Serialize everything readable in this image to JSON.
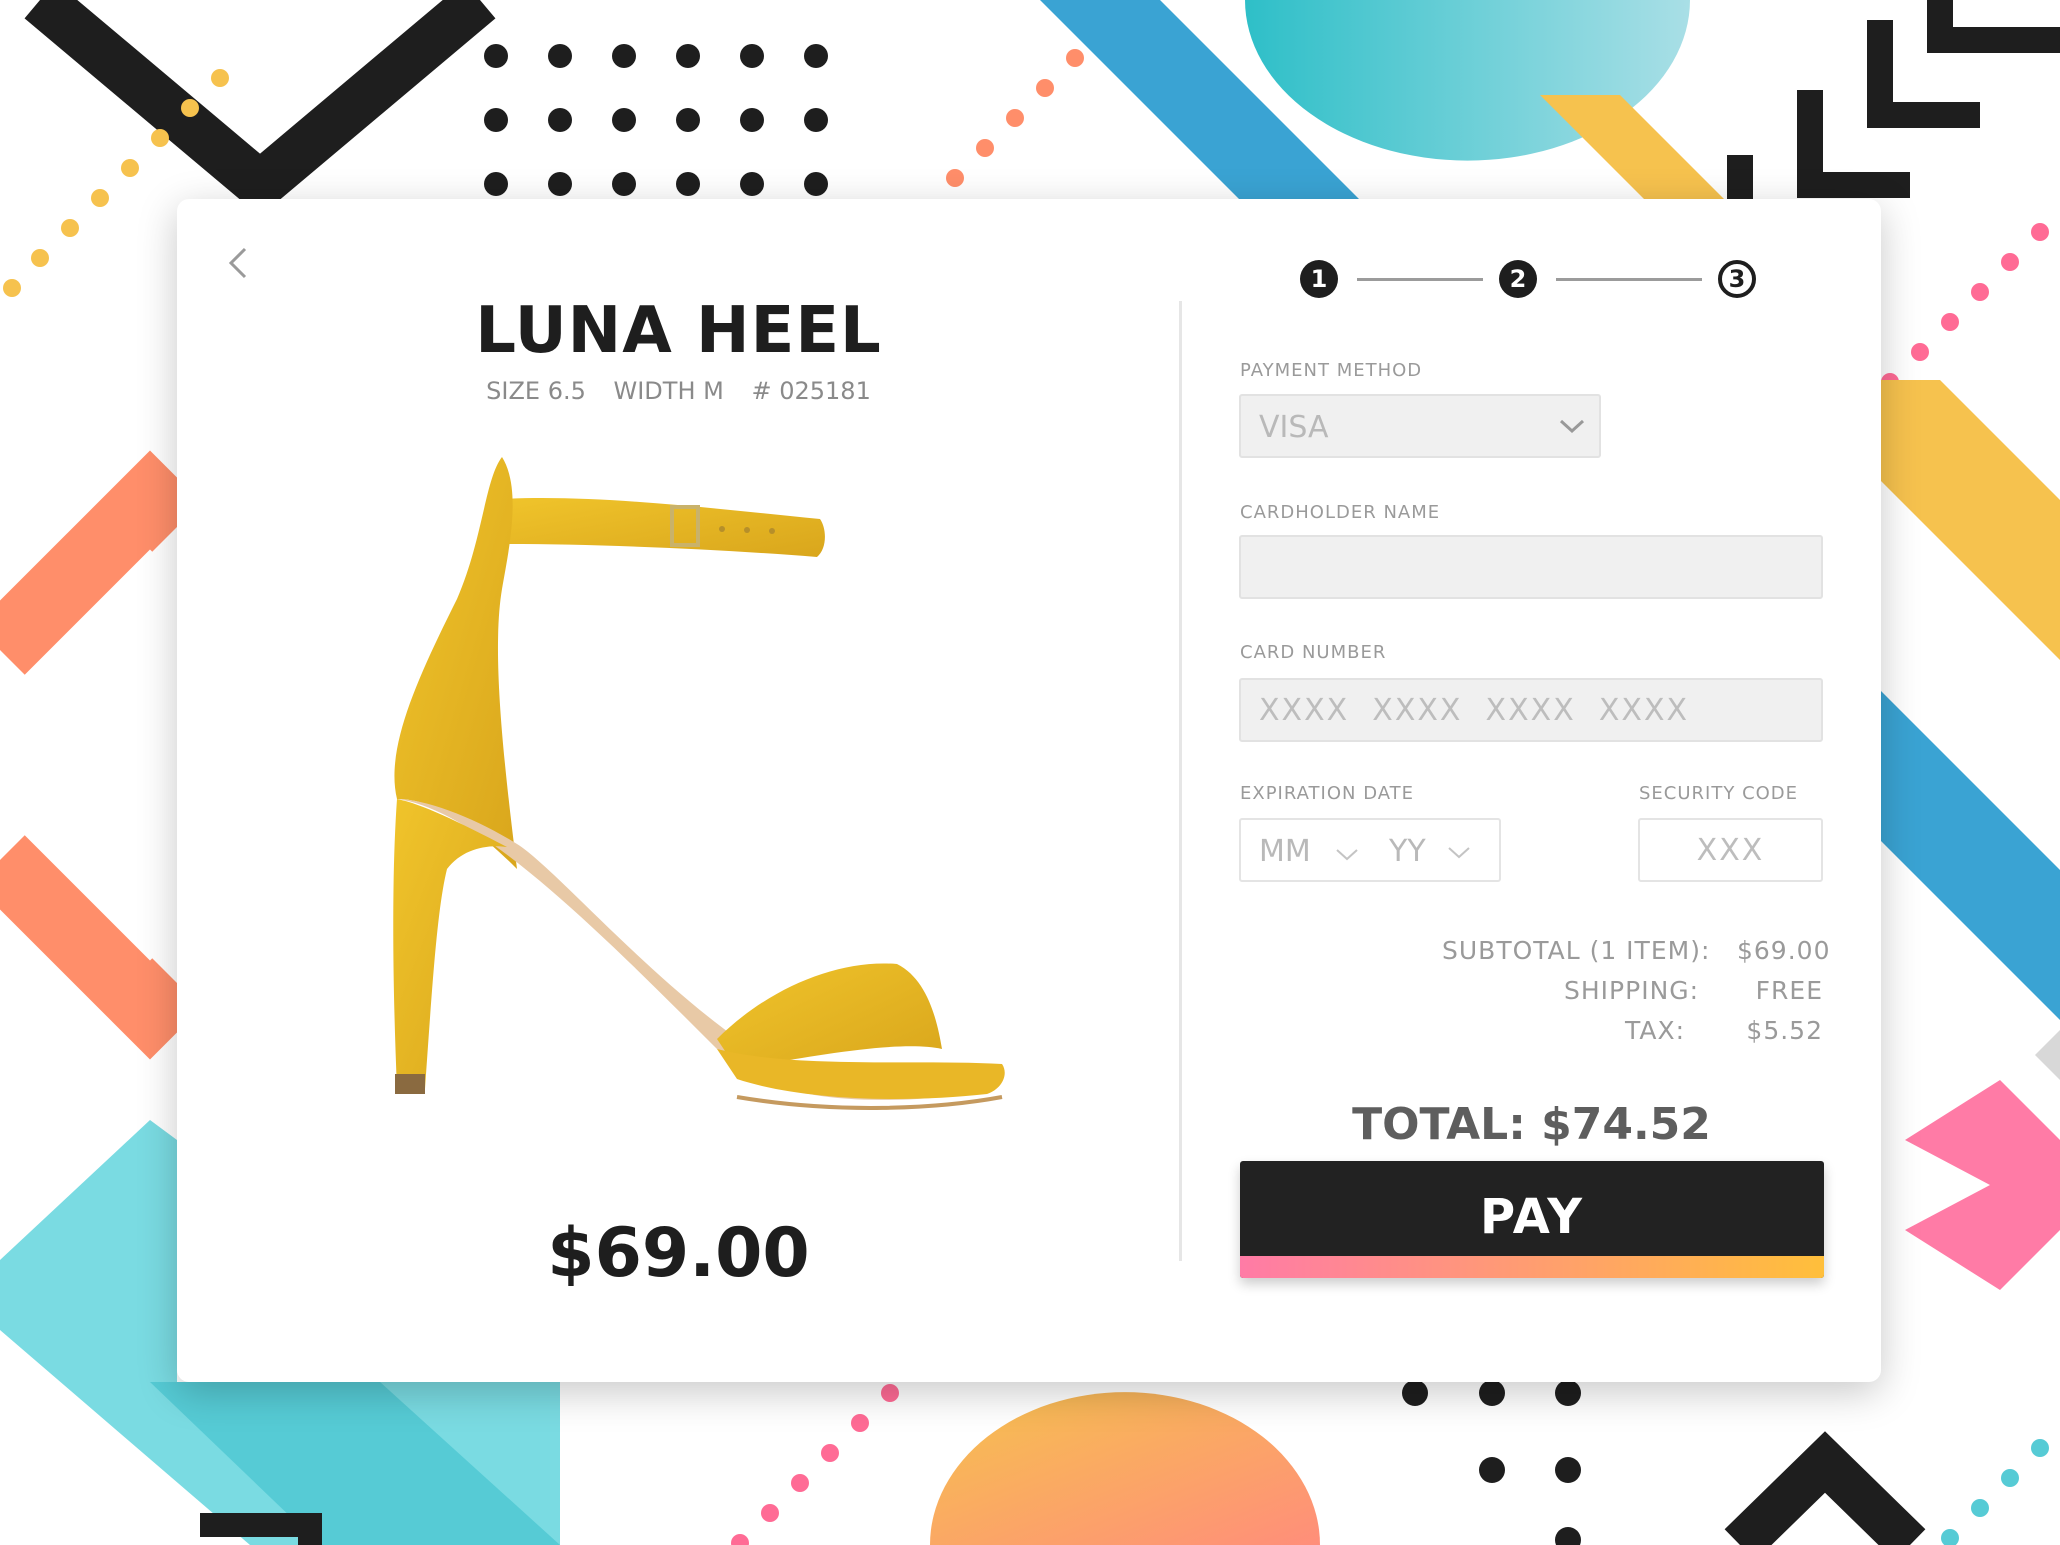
{
  "product": {
    "name": "LUNA HEEL",
    "size": "SIZE 6.5",
    "width": "WIDTH M",
    "sku": "# 025181",
    "price": "$69.00",
    "image": "yellow-suede-heel-sandal"
  },
  "steps": [
    "1",
    "2",
    "3"
  ],
  "form": {
    "payment_method_label": "PAYMENT METHOD",
    "payment_method_value": "VISA",
    "cardholder_label": "CARDHOLDER NAME",
    "cardholder_value": "",
    "card_number_label": "CARD NUMBER",
    "card_number_placeholder": "XXXX  XXXX  XXXX  XXXX",
    "expiration_label": "EXPIRATION DATE",
    "month_placeholder": "MM",
    "year_placeholder": "YY",
    "security_label": "SECURITY CODE",
    "security_placeholder": "XXX"
  },
  "summary": {
    "subtotal_label": "SUBTOTAL (1 ITEM):",
    "subtotal_value": "$69.00",
    "shipping_label": "SHIPPING:",
    "shipping_value": "FREE",
    "tax_label": "TAX:",
    "tax_value": "$5.52",
    "total": "TOTAL: $74.52"
  },
  "pay_label": "PAY",
  "colors": {
    "dark": "#1e1e1e",
    "pay_gradient_start": "#ff7ba6",
    "pay_gradient_end": "#ffbf3b",
    "shoe": "#e8b724"
  }
}
